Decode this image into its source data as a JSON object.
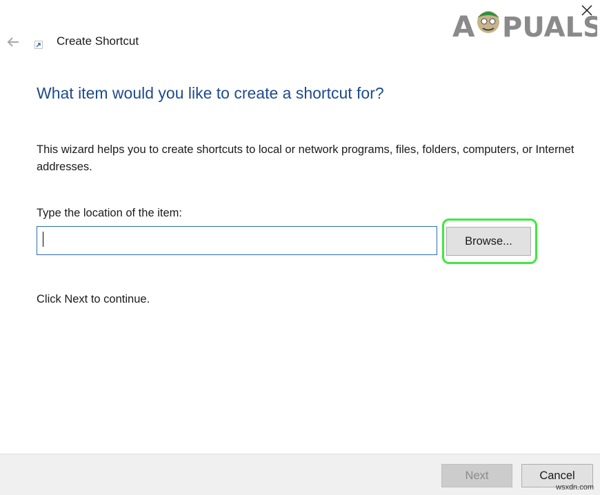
{
  "window": {
    "title": "Create Shortcut",
    "icons": {
      "back": "back-arrow-icon",
      "title": "shortcut-icon",
      "close": "close-icon"
    }
  },
  "watermark": {
    "text": "APPUALS"
  },
  "main": {
    "heading": "What item would you like to create a shortcut for?",
    "description": "This wizard helps you to create shortcuts to local or network programs, files, folders, computers, or Internet addresses.",
    "location_label": "Type the location of the item:",
    "location_value": "",
    "browse_label": "Browse...",
    "continue_text": "Click Next to continue."
  },
  "footer": {
    "next_label": "Next",
    "cancel_label": "Cancel"
  },
  "corner_mark": "wsxdn.com",
  "colors": {
    "heading": "#1e4a8c",
    "highlight": "#3ee83e",
    "input_border": "#2b6bb0",
    "footer_bg": "#f0f0f0"
  }
}
